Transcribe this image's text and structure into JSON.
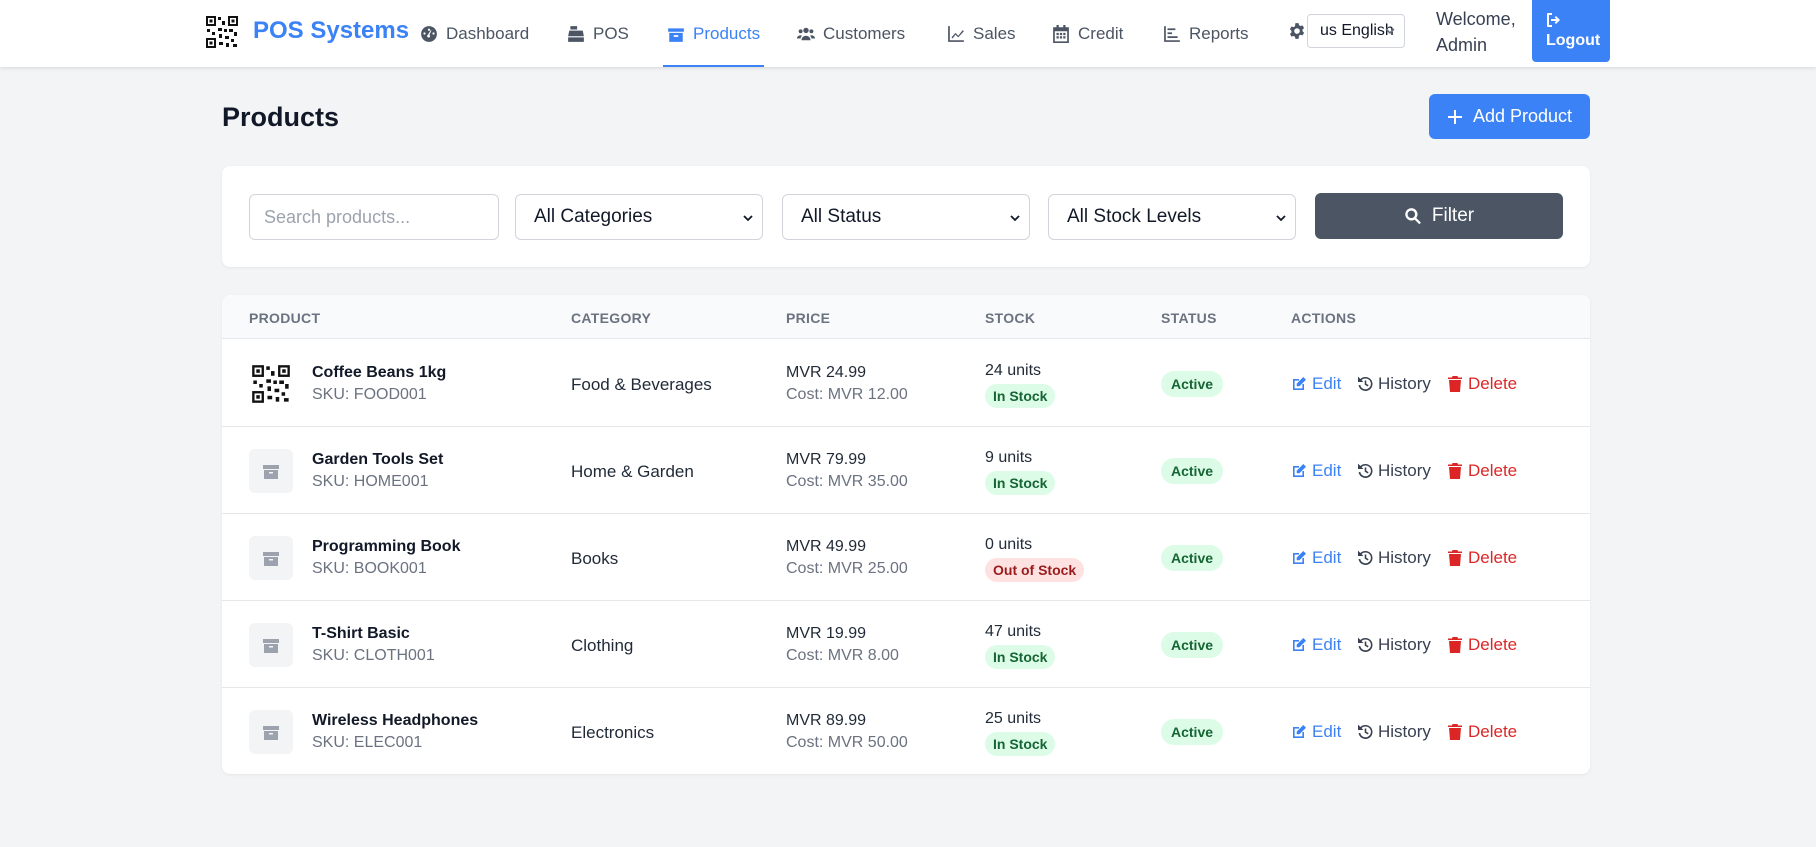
{
  "nav": {
    "brand": "POS Systems",
    "items": [
      {
        "label": "Dashboard",
        "icon": "dashboard-icon"
      },
      {
        "label": "POS",
        "icon": "cash-register-icon"
      },
      {
        "label": "Products",
        "icon": "box-icon",
        "active": true
      },
      {
        "label": "Customers",
        "icon": "users-icon"
      },
      {
        "label": "Sales",
        "icon": "chart-line-icon"
      },
      {
        "label": "Credit",
        "icon": "calendar-icon"
      },
      {
        "label": "Reports",
        "icon": "bar-chart-icon"
      }
    ],
    "settings_icon": "gear-icon",
    "language": "us English",
    "welcome": "Welcome, Admin",
    "logout": "Logout"
  },
  "page": {
    "title": "Products",
    "add_button": "Add Product"
  },
  "filters": {
    "search_placeholder": "Search products...",
    "category": "All Categories",
    "status": "All Status",
    "stock": "All Stock Levels",
    "filter_button": "Filter"
  },
  "table": {
    "headers": [
      "PRODUCT",
      "CATEGORY",
      "PRICE",
      "STOCK",
      "STATUS",
      "ACTIONS"
    ],
    "actions": {
      "edit": "Edit",
      "history": "History",
      "delete": "Delete"
    },
    "rows": [
      {
        "name": "Coffee Beans 1kg",
        "sku": "SKU: FOOD001",
        "category": "Food & Beverages",
        "price": "MVR 24.99",
        "cost": "Cost: MVR 12.00",
        "units": "24 units",
        "stock": "In Stock",
        "status": "Active"
      },
      {
        "name": "Garden Tools Set",
        "sku": "SKU: HOME001",
        "category": "Home & Garden",
        "price": "MVR 79.99",
        "cost": "Cost: MVR 35.00",
        "units": "9 units",
        "stock": "In Stock",
        "status": "Active"
      },
      {
        "name": "Programming Book",
        "sku": "SKU: BOOK001",
        "category": "Books",
        "price": "MVR 49.99",
        "cost": "Cost: MVR 25.00",
        "units": "0 units",
        "stock": "Out of Stock",
        "status": "Active"
      },
      {
        "name": "T-Shirt Basic",
        "sku": "SKU: CLOTH001",
        "category": "Clothing",
        "price": "MVR 19.99",
        "cost": "Cost: MVR 8.00",
        "units": "47 units",
        "stock": "In Stock",
        "status": "Active"
      },
      {
        "name": "Wireless Headphones",
        "sku": "SKU: ELEC001",
        "category": "Electronics",
        "price": "MVR 89.99",
        "cost": "Cost: MVR 50.00",
        "units": "25 units",
        "stock": "In Stock",
        "status": "Active"
      }
    ]
  }
}
